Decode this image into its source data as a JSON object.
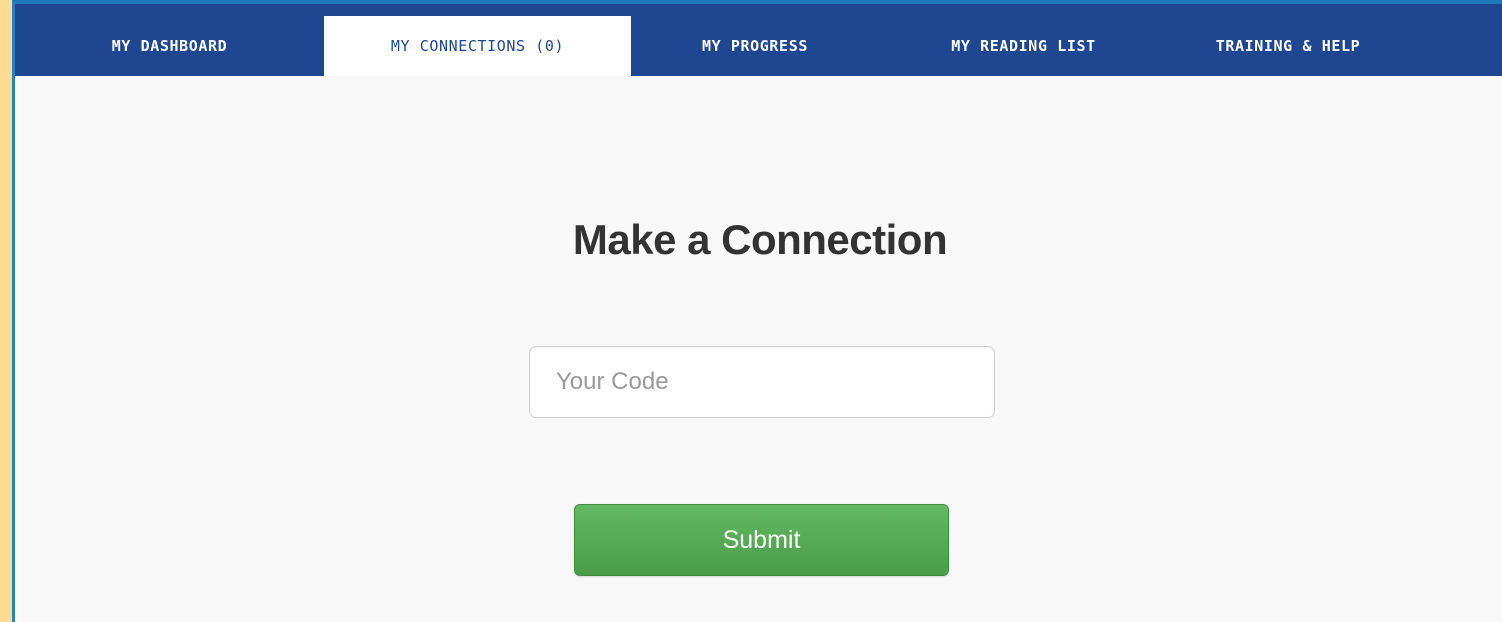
{
  "nav": {
    "tabs": [
      {
        "label": "MY DASHBOARD",
        "active": false
      },
      {
        "label": "MY CONNECTIONS (0)",
        "active": true
      },
      {
        "label": "MY PROGRESS",
        "active": false
      },
      {
        "label": "MY READING LIST",
        "active": false
      },
      {
        "label": "TRAINING & HELP",
        "active": false
      }
    ]
  },
  "main": {
    "title": "Make a Connection",
    "code_input": {
      "placeholder": "Your Code",
      "value": ""
    },
    "submit_label": "Submit"
  },
  "colors": {
    "nav_background": "#1f4791",
    "active_tab_text": "#1f4791",
    "page_background": "#f8f8f8",
    "outer_background": "#fbdc92",
    "submit_button": "#55a754"
  }
}
